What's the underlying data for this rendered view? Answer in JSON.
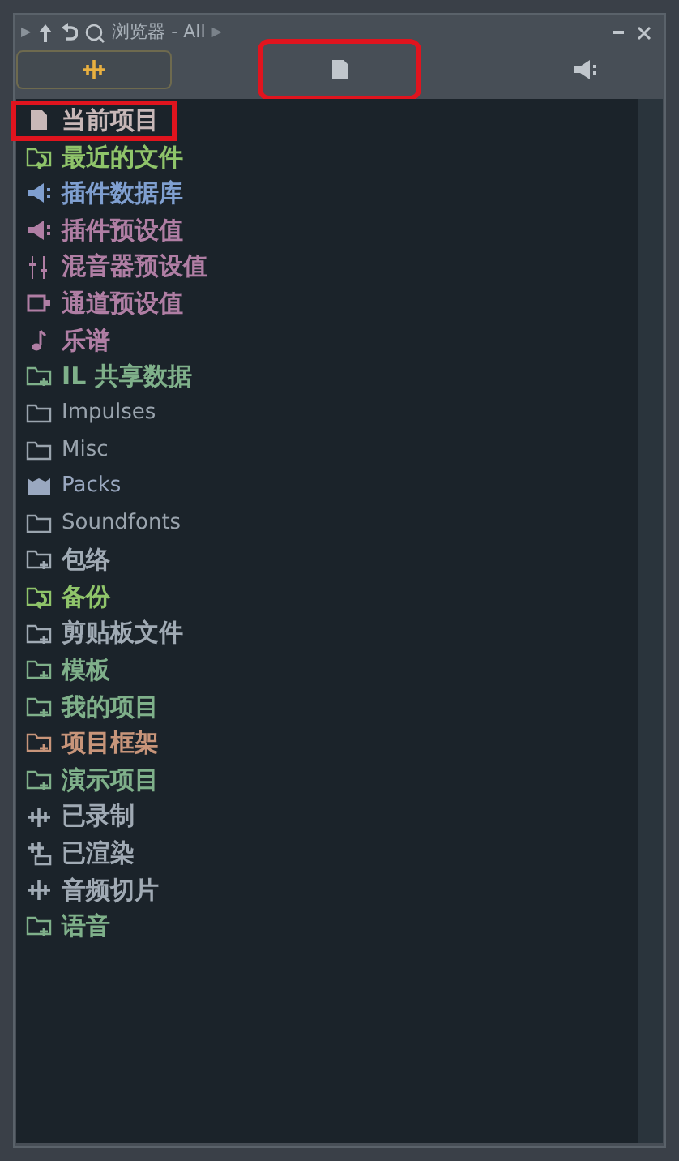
{
  "window": {
    "title": "浏览器 - All"
  },
  "nav": {
    "back": "▶",
    "forward": "▶"
  },
  "tabs": [
    {
      "kind": "wave",
      "selected": true,
      "highlighted": false
    },
    {
      "kind": "file",
      "selected": false,
      "highlighted": true
    },
    {
      "kind": "plugin",
      "selected": false,
      "highlighted": false
    }
  ],
  "items": [
    {
      "label": "当前项目",
      "kind": "file",
      "color": "#c8b8b8",
      "highlighted": true
    },
    {
      "label": "最近的文件",
      "kind": "recent",
      "color": "#8fc46a",
      "highlighted": false
    },
    {
      "label": "插件数据库",
      "kind": "plugin",
      "color": "#7f9fd0",
      "highlighted": false
    },
    {
      "label": "插件预设值",
      "kind": "plugin",
      "color": "#b07ea4",
      "highlighted": false
    },
    {
      "label": "混音器预设值",
      "kind": "mixer",
      "color": "#b07ea4",
      "highlighted": false
    },
    {
      "label": "通道预设值",
      "kind": "channel",
      "color": "#b07ea4",
      "highlighted": false
    },
    {
      "label": "乐谱",
      "kind": "score",
      "color": "#b07ea4",
      "highlighted": false
    },
    {
      "label": "IL 共享数据",
      "kind": "folderplus",
      "color": "#7fb08a",
      "highlighted": false
    },
    {
      "label": "Impulses",
      "kind": "folder",
      "color": "#9aa4ae",
      "highlighted": false
    },
    {
      "label": "Misc",
      "kind": "folder",
      "color": "#9aa4ae",
      "highlighted": false
    },
    {
      "label": "Packs",
      "kind": "packs",
      "color": "#9aa8c0",
      "highlighted": false
    },
    {
      "label": "Soundfonts",
      "kind": "folder",
      "color": "#9aa4ae",
      "highlighted": false
    },
    {
      "label": "包络",
      "kind": "folderplus",
      "color": "#a0aab4",
      "highlighted": false
    },
    {
      "label": "备份",
      "kind": "recent",
      "color": "#8fc46a",
      "highlighted": false
    },
    {
      "label": "剪贴板文件",
      "kind": "folderplus",
      "color": "#a0aab4",
      "highlighted": false
    },
    {
      "label": "模板",
      "kind": "folderplus",
      "color": "#7fb08a",
      "highlighted": false
    },
    {
      "label": "我的项目",
      "kind": "folderplus",
      "color": "#7fb08a",
      "highlighted": false
    },
    {
      "label": "项目框架",
      "kind": "folderplus",
      "color": "#c8957a",
      "highlighted": false
    },
    {
      "label": "演示项目",
      "kind": "folderplus",
      "color": "#7fb08a",
      "highlighted": false
    },
    {
      "label": "已录制",
      "kind": "wave",
      "color": "#a0aab4",
      "highlighted": false
    },
    {
      "label": "已渲染",
      "kind": "render",
      "color": "#a0aab4",
      "highlighted": false
    },
    {
      "label": "音频切片",
      "kind": "wave",
      "color": "#a0aab4",
      "highlighted": false
    },
    {
      "label": "语音",
      "kind": "folderplus",
      "color": "#7fb08a",
      "highlighted": false
    }
  ]
}
